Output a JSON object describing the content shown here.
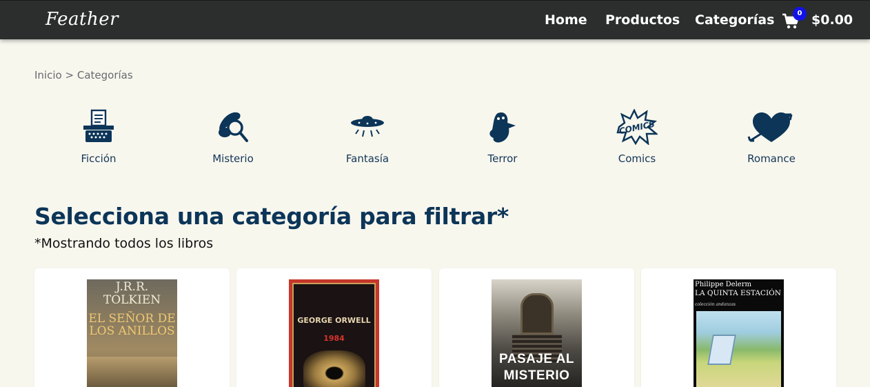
{
  "navbar": {
    "brand": "Feather",
    "links": [
      "Home",
      "Productos",
      "Categorías"
    ],
    "cart": {
      "icon": "cart-icon",
      "count": "0",
      "total": "$0.00"
    },
    "colors": {
      "background": "#2c2e2d",
      "badge": "#1212e8"
    }
  },
  "breadcrumb": {
    "home": "Inicio",
    "separator": ">",
    "current": "Categorías"
  },
  "categories": [
    {
      "label": "Ficción",
      "icon": "typewriter-icon"
    },
    {
      "label": "Misterio",
      "icon": "magnifier-icon"
    },
    {
      "label": "Fantasía",
      "icon": "ufo-icon"
    },
    {
      "label": "Terror",
      "icon": "ghost-icon"
    },
    {
      "label": "Comics",
      "icon": "comics-icon"
    },
    {
      "label": "Romance",
      "icon": "heart-arrow-icon"
    }
  ],
  "section": {
    "title": "Selecciona una categoría para filtrar*",
    "subtitle": "*Mostrando todos los libros"
  },
  "books": [
    {
      "cover_author": "J.R.R. TOLKIEN",
      "cover_title": "EL SEÑOR DE LOS ANILLOS"
    },
    {
      "cover_author": "GEORGE ORWELL",
      "cover_title": "1984"
    },
    {
      "cover_title": "PASAJE AL MISTERIO"
    },
    {
      "cover_author": "Philippe Delerm",
      "cover_title": "LA QUINTA ESTACIÓN",
      "cover_collection": "colección andanzas"
    }
  ],
  "theme": {
    "page_bg": "#f8f7ee",
    "accent": "#0c3558"
  }
}
